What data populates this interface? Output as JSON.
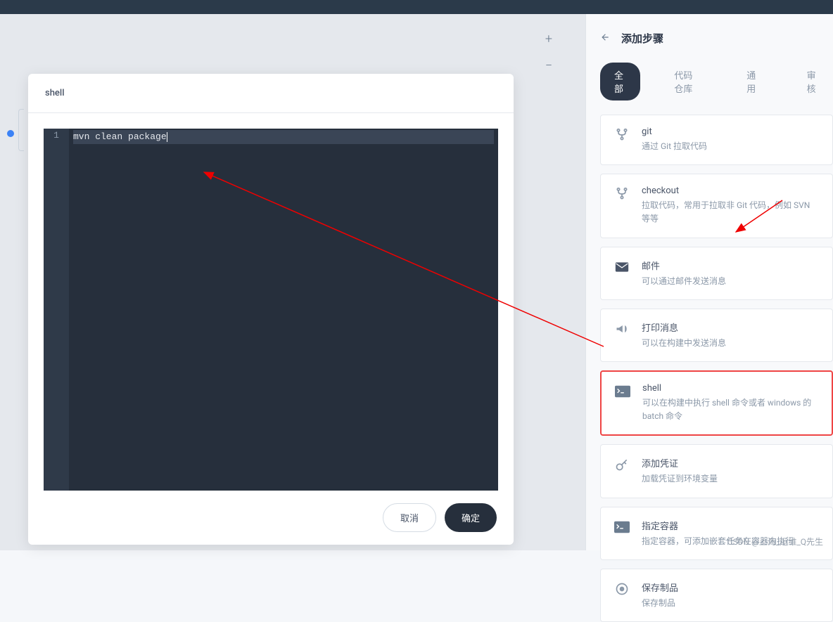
{
  "modal": {
    "title": "shell",
    "code": "mvn clean package",
    "line_number": "1",
    "cancel_label": "取消",
    "confirm_label": "确定"
  },
  "sidebar": {
    "title": "添加步骤",
    "tabs": [
      {
        "label": "全部",
        "active": true
      },
      {
        "label": "代码仓库",
        "active": false
      },
      {
        "label": "通用",
        "active": false
      },
      {
        "label": "审核",
        "active": false
      }
    ],
    "steps": [
      {
        "icon": "branch",
        "title": "git",
        "desc": "通过 Git 拉取代码"
      },
      {
        "icon": "branch",
        "title": "checkout",
        "desc": "拉取代码，常用于拉取非 Git 代码，例如 SVN 等等"
      },
      {
        "icon": "mail",
        "title": "邮件",
        "desc": "可以通过邮件发送消息"
      },
      {
        "icon": "horn",
        "title": "打印消息",
        "desc": "可以在构建中发送消息"
      },
      {
        "icon": "terminal",
        "title": "shell",
        "desc": "可以在构建中执行 shell 命令或者 windows 的 batch 命令",
        "highlighted": true
      },
      {
        "icon": "key",
        "title": "添加凭证",
        "desc": "加载凭证到环境变量"
      },
      {
        "icon": "terminal",
        "title": "指定容器",
        "desc": "指定容器，可添加嵌套任务在容器内执行"
      },
      {
        "icon": "disc",
        "title": "保存制品",
        "desc": "保存制品"
      }
    ]
  },
  "watermark": "CSDN @上海_运维_Q先生"
}
